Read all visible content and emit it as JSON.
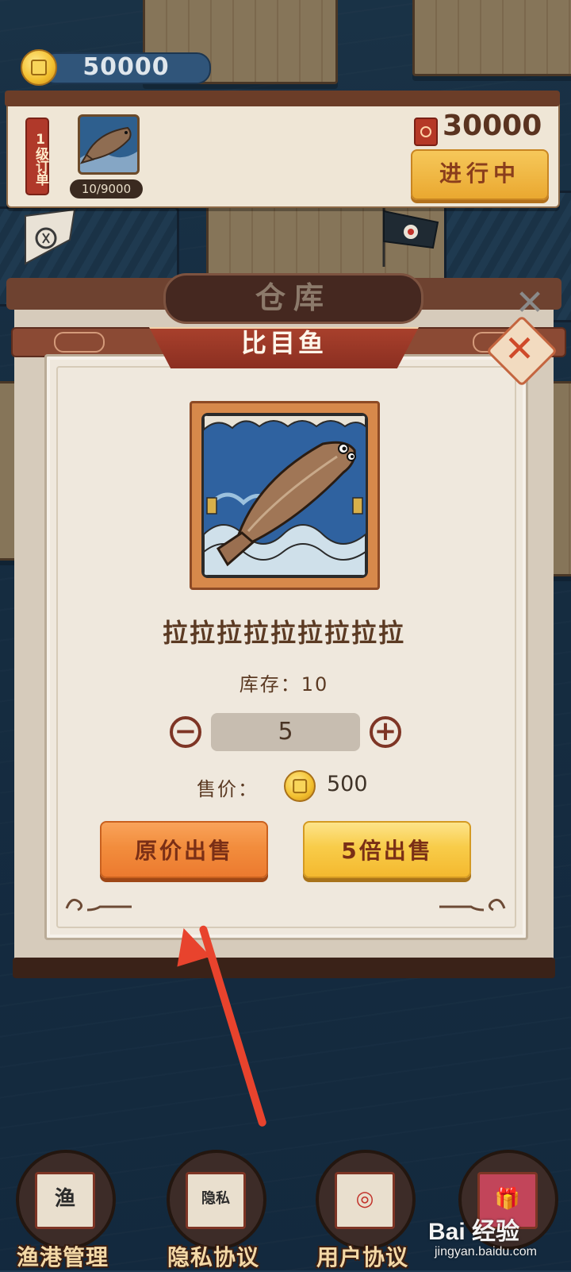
{
  "hud": {
    "coin_amount": "50000",
    "coin_icon": "gold-coin-icon"
  },
  "order": {
    "level_label": "1级订单",
    "fish_icon": "halibut-icon",
    "progress": "10/9000",
    "reward_icon": "red-envelope-icon",
    "reward_amount": "30000",
    "status_button": "进行中"
  },
  "warehouse": {
    "title": "仓库",
    "close_icon": "close-icon"
  },
  "dialog": {
    "title": "比目鱼",
    "close_icon": "close-icon",
    "fish_image": "halibut-icon",
    "description": "拉拉拉拉拉拉拉拉拉",
    "stock_text": "库存：10",
    "quantity": "5",
    "minus_icon": "minus-circle-icon",
    "plus_icon": "plus-circle-icon",
    "price_label": "售价：",
    "price_icon": "gold-coin-icon",
    "price_value": "500",
    "sell_original_label": "原价出售",
    "sell_5x_label": "5倍出售"
  },
  "annotation": {
    "arrow_color": "#e8432d"
  },
  "bottom_nav": [
    {
      "label": "渔港管理",
      "emblem": "渔"
    },
    {
      "label": "隐私协议",
      "emblem": "隐私"
    },
    {
      "label": "用户协议",
      "emblem": "◎"
    },
    {
      "label": "",
      "emblem": "🎁"
    }
  ],
  "watermark": {
    "brand": "Bai 经验",
    "url": "jingyan.baidu.com"
  },
  "colors": {
    "accent_red": "#a8402c",
    "button_orange": "#f28d3d",
    "button_yellow": "#f8cc49",
    "panel_bg": "#efe8dd",
    "text_brown": "#5b3a23"
  }
}
